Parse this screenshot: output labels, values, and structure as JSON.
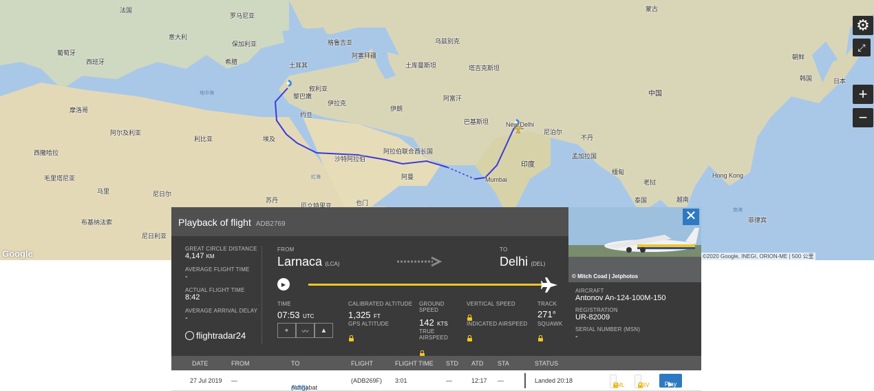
{
  "map": {
    "labels": [
      {
        "text": "法国",
        "cls": ""
      },
      {
        "text": "罗马尼亚",
        "cls": ""
      },
      {
        "text": "意大利",
        "cls": ""
      },
      {
        "text": "保加利亚",
        "cls": ""
      },
      {
        "text": "葡萄牙",
        "cls": ""
      },
      {
        "text": "西班牙",
        "cls": ""
      },
      {
        "text": "希腊",
        "cls": ""
      },
      {
        "text": "土耳其",
        "cls": ""
      },
      {
        "text": "格鲁吉亚",
        "cls": ""
      },
      {
        "text": "阿塞拜疆",
        "cls": ""
      },
      {
        "text": "乌兹别克",
        "cls": ""
      },
      {
        "text": "土库曼斯坦",
        "cls": ""
      },
      {
        "text": "塔吉克斯坦",
        "cls": ""
      },
      {
        "text": "蒙古",
        "cls": ""
      },
      {
        "text": "中国",
        "cls": "big"
      },
      {
        "text": "日本",
        "cls": ""
      },
      {
        "text": "朝鲜",
        "cls": ""
      },
      {
        "text": "韩国",
        "cls": ""
      },
      {
        "text": "叙利亚",
        "cls": ""
      },
      {
        "text": "黎巴嫩",
        "cls": ""
      },
      {
        "text": "伊拉克",
        "cls": ""
      },
      {
        "text": "伊朗",
        "cls": ""
      },
      {
        "text": "阿富汗",
        "cls": ""
      },
      {
        "text": "巴基斯坦",
        "cls": ""
      },
      {
        "text": "尼泊尔",
        "cls": ""
      },
      {
        "text": "不丹",
        "cls": ""
      },
      {
        "text": "印度",
        "cls": "big"
      },
      {
        "text": "孟加拉国",
        "cls": ""
      },
      {
        "text": "缅甸",
        "cls": ""
      },
      {
        "text": "老挝",
        "cls": ""
      },
      {
        "text": "泰国",
        "cls": ""
      },
      {
        "text": "越南",
        "cls": ""
      },
      {
        "text": "菲律宾",
        "cls": ""
      },
      {
        "text": "摩洛哥",
        "cls": ""
      },
      {
        "text": "阿尔及利亚",
        "cls": ""
      },
      {
        "text": "利比亚",
        "cls": ""
      },
      {
        "text": "埃及",
        "cls": ""
      },
      {
        "text": "约旦",
        "cls": ""
      },
      {
        "text": "沙特阿拉伯",
        "cls": ""
      },
      {
        "text": "阿拉伯联合酋长国",
        "cls": ""
      },
      {
        "text": "阿曼",
        "cls": ""
      },
      {
        "text": "西撒哈拉",
        "cls": ""
      },
      {
        "text": "毛里塔尼亚",
        "cls": ""
      },
      {
        "text": "马里",
        "cls": ""
      },
      {
        "text": "尼日尔",
        "cls": ""
      },
      {
        "text": "苏丹",
        "cls": ""
      },
      {
        "text": "厄立特里亚",
        "cls": ""
      },
      {
        "text": "也门",
        "cls": ""
      },
      {
        "text": "布基纳法索",
        "cls": ""
      },
      {
        "text": "尼日利亚",
        "cls": ""
      },
      {
        "text": "Mumbai",
        "cls": ""
      },
      {
        "text": "New Delhi",
        "cls": ""
      },
      {
        "text": "Hong Kong",
        "cls": ""
      },
      {
        "text": "地中海",
        "cls": "sea"
      },
      {
        "text": "红海",
        "cls": "sea"
      },
      {
        "text": "南海",
        "cls": "sea"
      }
    ],
    "attribution": "©2020 Google, INEGI, ORION-ME | 500 公里",
    "google": "Google"
  },
  "controls": {
    "settings": "gear-icon",
    "fullscreen": "expand-icon",
    "zoom_in": "+",
    "zoom_out": "−"
  },
  "panel": {
    "title": "Playback of flight",
    "flight_id": "ADB2769",
    "gc_distance_label": "GREAT CIRCLE DISTANCE",
    "gc_distance_value": "4,147",
    "gc_distance_unit": "KM",
    "avg_time_label": "AVERAGE FLIGHT TIME",
    "avg_time_value": "-",
    "actual_time_label": "ACTUAL FLIGHT TIME",
    "actual_time_value": "8:42",
    "avg_delay_label": "AVERAGE ARRIVAL DELAY",
    "avg_delay_value": "-",
    "brand": "flightradar24",
    "from_label": "FROM",
    "from_city": "Larnaca",
    "from_code": "(LCA)",
    "to_label": "TO",
    "to_city": "Delhi",
    "to_code": "(DEL)",
    "progress": 1.0,
    "time_label": "TIME",
    "time_value": "07:53",
    "time_unit": "UTC",
    "cal_alt_label": "CALIBRATED ALTITUDE",
    "cal_alt_value": "1,325",
    "cal_alt_unit": "FT",
    "gps_alt_label": "GPS ALTITUDE",
    "ground_speed_label_1": "GROUND",
    "ground_speed_label_2": "SPEED",
    "ground_speed_value": "142",
    "ground_speed_unit": "KTS",
    "true_as_label_1": "TRUE",
    "true_as_label_2": "AIRSPEED",
    "vspeed_label": "VERTICAL SPEED",
    "ias_label": "INDICATED AIRSPEED",
    "track_label": "TRACK",
    "track_value": "271°",
    "squawk_label": "SQUAWK",
    "photo_credit": "© Mitch Coad | Jetphotos",
    "aircraft_label": "AIRCRAFT",
    "aircraft_value": "Antonov An-124-100M-150",
    "registration_label": "REGISTRATION",
    "registration_value": "UR-82009",
    "msn_label": "SERIAL NUMBER (MSN)",
    "msn_value": "-"
  },
  "table": {
    "headers": {
      "date": "DATE",
      "from": "FROM",
      "to": "TO",
      "flight": "FLIGHT",
      "flight_time": "FLIGHT TIME",
      "std": "STD",
      "atd": "ATD",
      "sta": "STA",
      "status": "STATUS"
    },
    "row": {
      "date": "27 Jul 2019",
      "from": "—",
      "to_city": "Ashgabat",
      "to_code": "(ASB)",
      "flight": "(ADB269F)",
      "flight_time": "3:01",
      "std": "—",
      "atd": "12:17",
      "sta": "—",
      "status": "Landed 20:18",
      "kml": "KML",
      "csv": "CSV",
      "play": "Play"
    }
  },
  "colors": {
    "track": "#3a3adc",
    "accent": "#2f79c2",
    "progress": "#f3c623",
    "lock": "#f3c623"
  }
}
